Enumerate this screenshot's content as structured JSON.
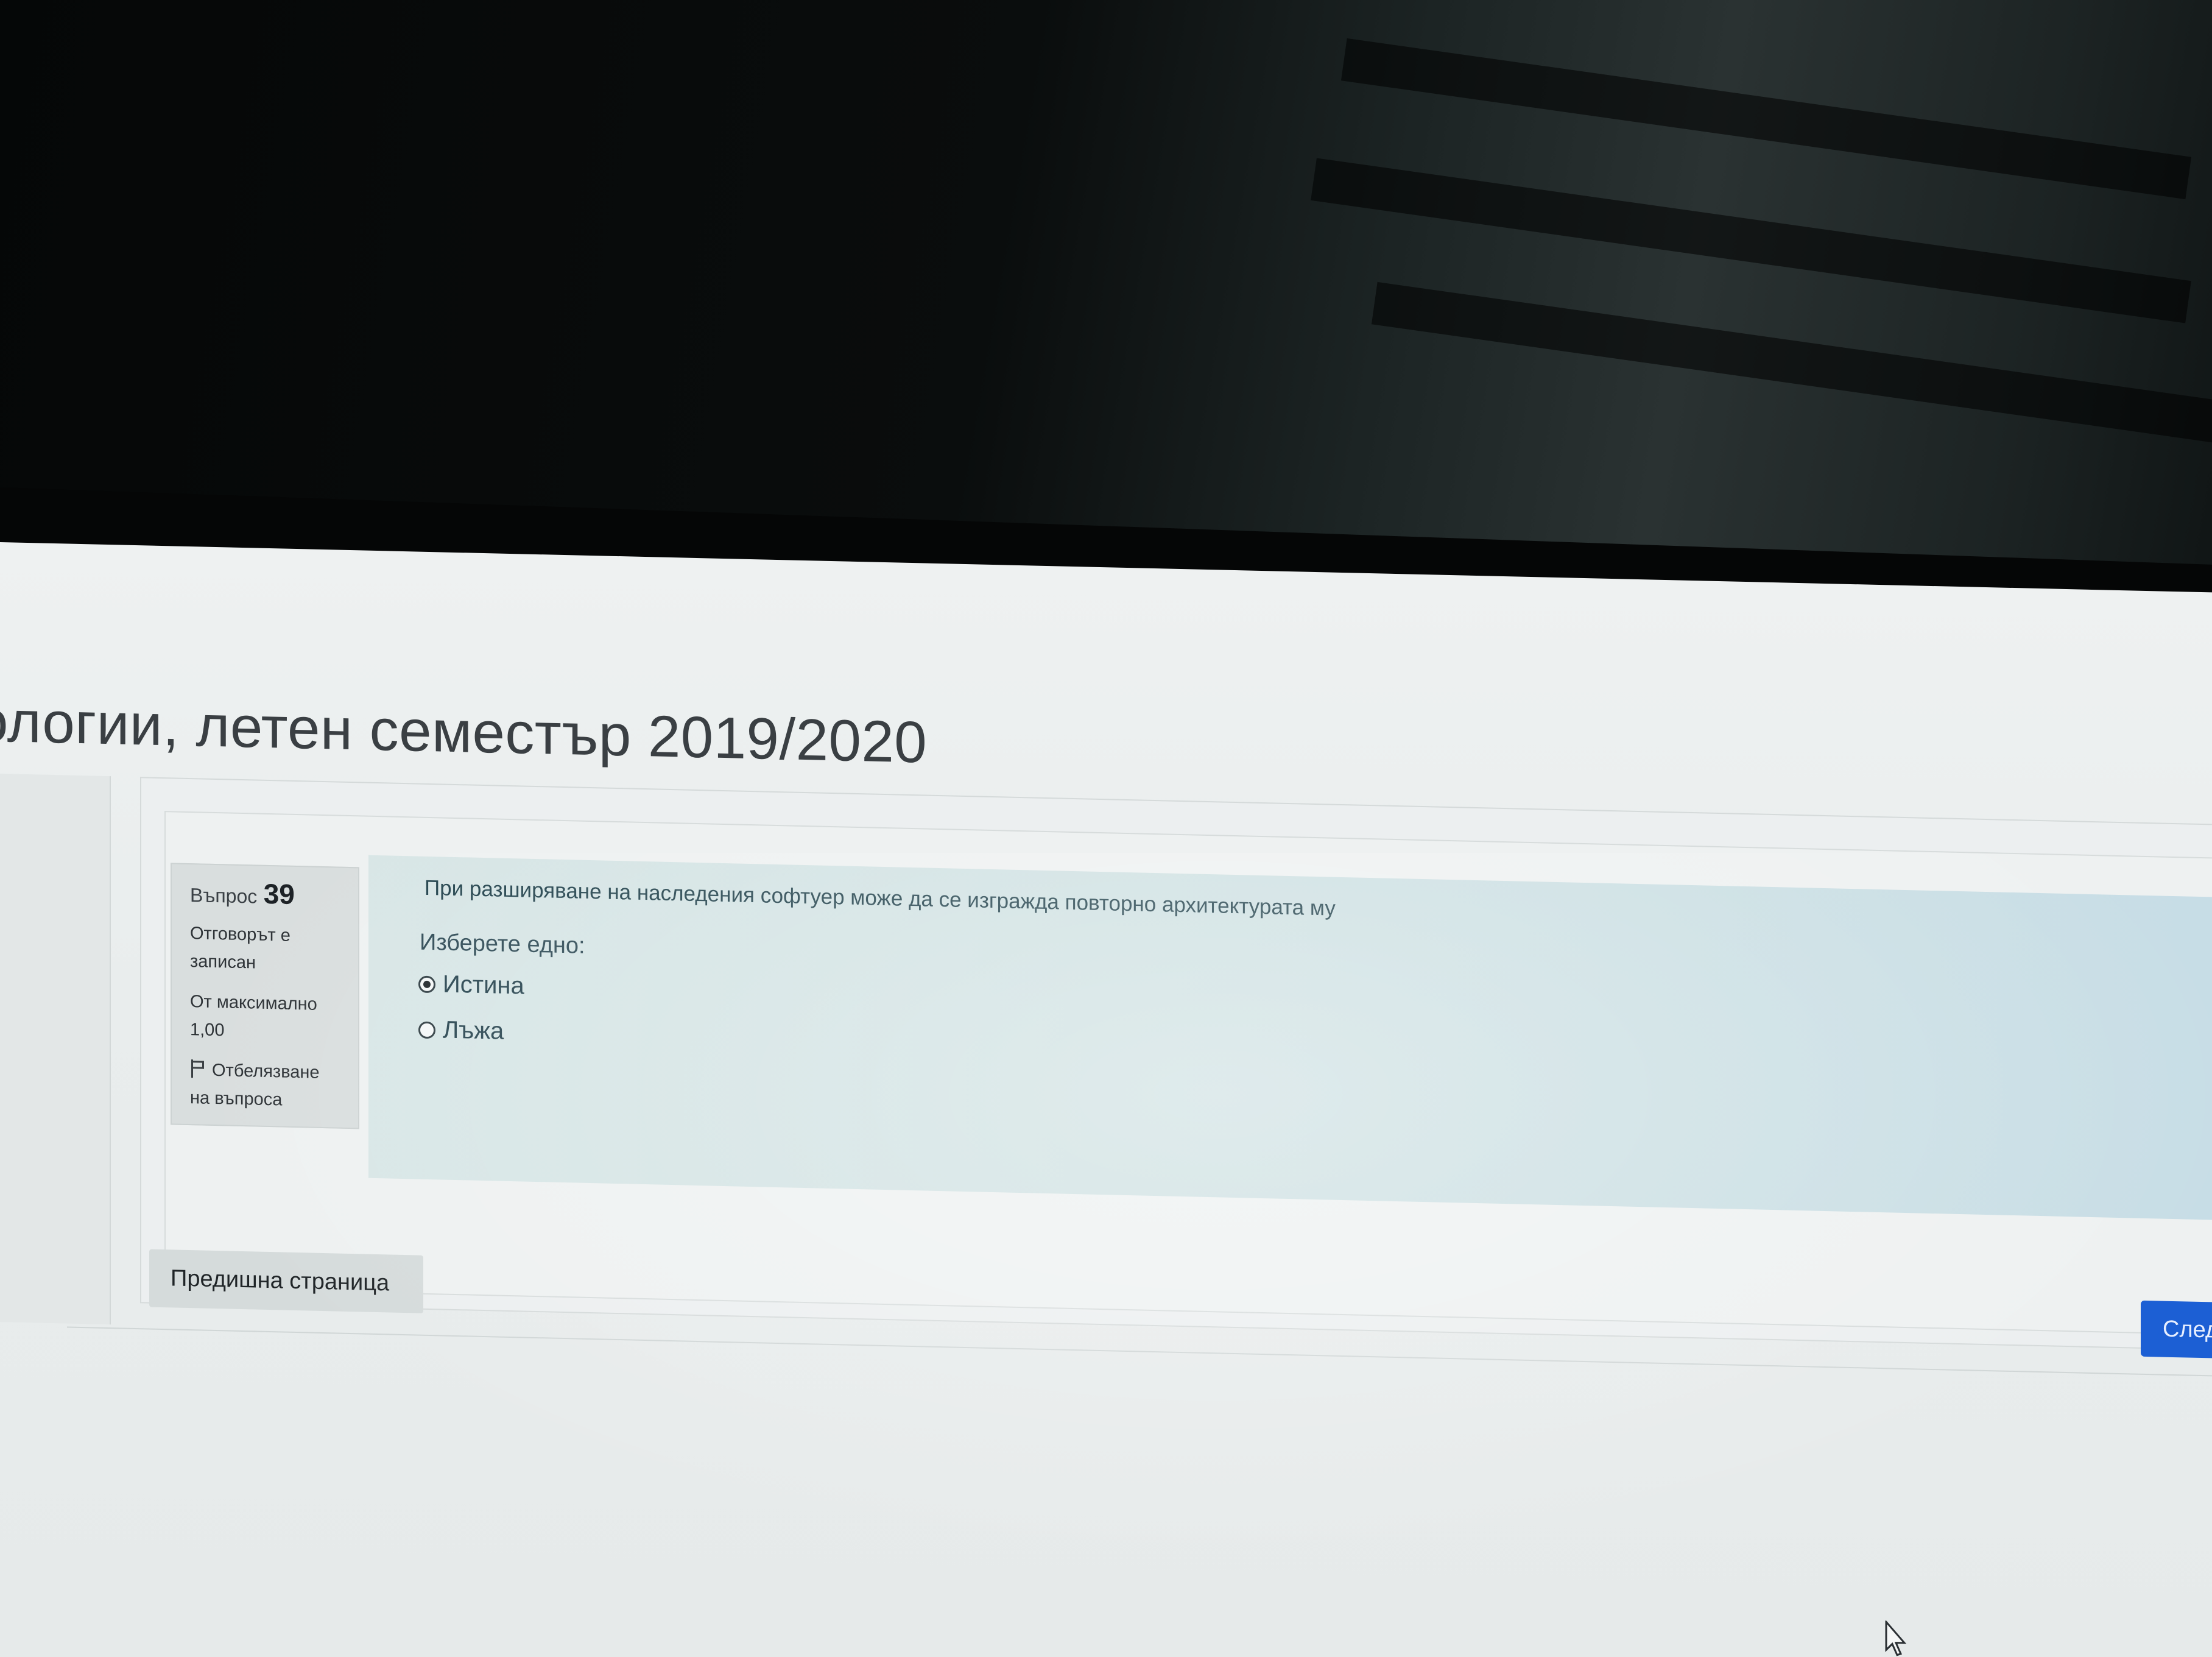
{
  "page": {
    "title": "ологии, летен семестър 2019/2020"
  },
  "question": {
    "number_label": "Въпрос",
    "number": "39",
    "status": "Отговорът е записан",
    "max_points": "От максимално 1,00",
    "flag_label": "Отбелязване на въпроса",
    "text": "При разширяване на наследения софтуер може да се изгражда повторно архитектурата му",
    "prompt": "Изберете едно:",
    "answers": [
      {
        "label": "Истина",
        "selected": true
      },
      {
        "label": "Лъжа",
        "selected": false
      }
    ]
  },
  "navigation": {
    "prev_label": "Предишна страница",
    "next_label": "След"
  },
  "colors": {
    "content_background": "#cfe1e2",
    "info_background": "#d9dede",
    "next_button": "#1c5fd4"
  },
  "icons": {
    "flag": "flag-icon",
    "radio": "radio-icon",
    "cursor": "mouse-pointer-icon"
  }
}
